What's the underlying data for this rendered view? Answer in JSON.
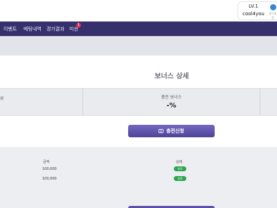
{
  "header": {
    "user": {
      "level": "LV.1",
      "username": "cool4you"
    },
    "logout_label": "로그아웃"
  },
  "nav": {
    "items": [
      {
        "label": "이벤트"
      },
      {
        "label": "베팅내역"
      },
      {
        "label": "경기결과"
      },
      {
        "label": "미션",
        "badge": "1"
      }
    ]
  },
  "bonus": {
    "title": "보너스 상세",
    "left_label": "류",
    "card_label": "충전 보너스",
    "card_value": "-%",
    "apply_button": "충전신청"
  },
  "history": {
    "columns": {
      "amount": "금액",
      "status": "상태"
    },
    "rows": [
      {
        "amount": "100,000",
        "status": "완료"
      },
      {
        "amount": "100,000",
        "status": "완료"
      }
    ]
  },
  "colors": {
    "nav_bg": "#36306d",
    "button": "#5a4ea6",
    "badge_red": "#e0334a",
    "status_green": "#2aa54a",
    "logout_blue": "#3a84d6"
  },
  "icons": {
    "logout": "logout-icon",
    "apply": "gift-icon"
  }
}
